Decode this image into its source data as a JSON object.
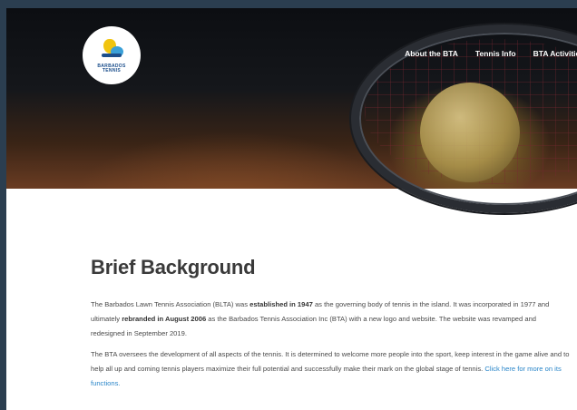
{
  "logo": {
    "text_line1": "BARBADOS",
    "text_line2": "TENNIS"
  },
  "nav": [
    {
      "label": "About the BTA"
    },
    {
      "label": "Tennis Info"
    },
    {
      "label": "BTA Activities"
    }
  ],
  "main": {
    "title": "Brief Background",
    "p1": {
      "t1": "The Barbados Lawn Tennis Association (BLTA) was ",
      "b1": "established in 1947",
      "t2": " as the governing body of tennis in the island. It was incorporated in 1977 and ultimately ",
      "b2": "rebranded in August 2006",
      "t3": " as the Barbados Tennis Association Inc (BTA) with a new logo and website. The website was revamped and redesigned in September 2019."
    },
    "p2": {
      "t1": "The BTA oversees the development of all aspects of the tennis. It is  determined to welcome more people into the sport, keep interest in the game alive and to help all up and coming tennis players maximize their full potential and successfully make their mark on the global stage of tennis. ",
      "link": "Click here for more on its functions."
    }
  }
}
